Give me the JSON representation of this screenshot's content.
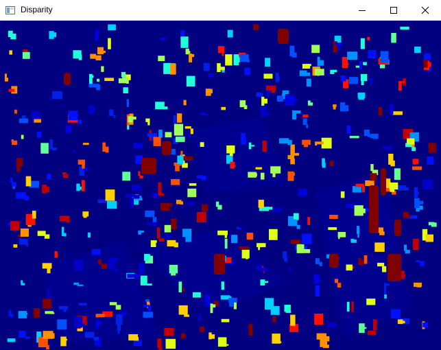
{
  "window": {
    "title": "Disparity",
    "icon": "app-window-icon"
  },
  "controls": {
    "minimize_icon": "minimize-icon",
    "maximize_icon": "maximize-icon",
    "close_icon": "close-icon"
  },
  "image": {
    "content": "disparity-map",
    "background_color": "#000080",
    "colormap": "jet"
  }
}
